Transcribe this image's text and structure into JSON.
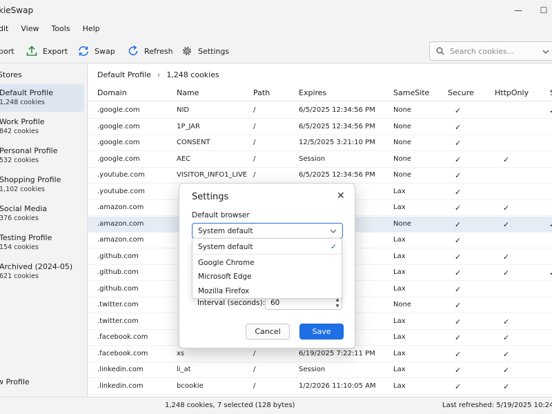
{
  "window": {
    "title": "kieSwap",
    "minimize_glyph": "—",
    "maximize_glyph": "☐"
  },
  "menu": [
    "dit",
    "View",
    "Tools",
    "Help"
  ],
  "toolbar": {
    "import_label": "port",
    "export_label": "Export",
    "swap_label": "Swap",
    "refresh_label": "Refresh",
    "settings_label": "Settings",
    "accent_color": "#1f6fe5",
    "export_icon_color": "#2f8f3a"
  },
  "search": {
    "placeholder": "Search cookies..."
  },
  "sidebar": {
    "header": "Stores",
    "profiles": [
      {
        "name": "Default Profile",
        "count": "1,248 cookies"
      },
      {
        "name": "Work Profile",
        "count": "842 cookies"
      },
      {
        "name": "Personal Profile",
        "count": "532 cookies"
      },
      {
        "name": "Shopping Profile",
        "count": "1,102 cookies"
      },
      {
        "name": "Social Media",
        "count": "376 cookies"
      },
      {
        "name": "Testing Profile",
        "count": "154 cookies"
      },
      {
        "name": "Archived (2024-05)",
        "count": "621 cookies"
      }
    ],
    "new_profile": "w Profile"
  },
  "breadcrumb": {
    "profile": "Default Profile",
    "count": "1,248 cookies"
  },
  "table": {
    "columns": [
      "Domain",
      "Name",
      "Path",
      "Expires",
      "SameSite",
      "Secure",
      "HttpOnly",
      "S"
    ],
    "check_glyph": "✓",
    "rows": [
      {
        "domain": ".google.com",
        "name": "NID",
        "path": "/",
        "expires": "6/5/2025 12:34:56 PM",
        "samesite": "None",
        "secure": "✓",
        "httponly": "",
        "extra": "✓"
      },
      {
        "domain": ".google.com",
        "name": "1P_JAR",
        "path": "/",
        "expires": "6/5/2025 12:34:56 PM",
        "samesite": "None",
        "secure": "✓",
        "httponly": "",
        "extra": ""
      },
      {
        "domain": ".google.com",
        "name": "CONSENT",
        "path": "/",
        "expires": "12/5/2025 3:21:10 PM",
        "samesite": "None",
        "secure": "✓",
        "httponly": "",
        "extra": ""
      },
      {
        "domain": ".google.com",
        "name": "AEC",
        "path": "/",
        "expires": "Session",
        "samesite": "None",
        "secure": "✓",
        "httponly": "✓",
        "extra": ""
      },
      {
        "domain": ".youtube.com",
        "name": "VISITOR_INFO1_LIVE",
        "path": "/",
        "expires": "6/5/2025 12:34:56 PM",
        "samesite": "None",
        "secure": "✓",
        "httponly": "",
        "extra": ""
      },
      {
        "domain": ".youtube.com",
        "name": "",
        "path": "",
        "expires": "",
        "samesite": "Lax",
        "secure": "✓",
        "httponly": "",
        "extra": ""
      },
      {
        "domain": ".amazon.com",
        "name": "",
        "path": "",
        "expires": "AM",
        "samesite": "Lax",
        "secure": "✓",
        "httponly": "✓",
        "extra": ""
      },
      {
        "domain": ".amazon.com",
        "name": "",
        "path": "",
        "expires": "AM",
        "samesite": "None",
        "secure": "✓",
        "httponly": "✓",
        "extra": "✓"
      },
      {
        "domain": ".amazon.com",
        "name": "",
        "path": "",
        "expires": "",
        "samesite": "Lax",
        "secure": "✓",
        "httponly": "",
        "extra": ""
      },
      {
        "domain": ".github.com",
        "name": "",
        "path": "",
        "expires": "",
        "samesite": "Lax",
        "secure": "✓",
        "httponly": "✓",
        "extra": ""
      },
      {
        "domain": ".github.com",
        "name": "",
        "path": "",
        "expires": "AM",
        "samesite": "Lax",
        "secure": "✓",
        "httponly": "✓",
        "extra": "✓"
      },
      {
        "domain": ".github.com",
        "name": "",
        "path": "",
        "expires": "AM",
        "samesite": "Lax",
        "secure": "✓",
        "httponly": "",
        "extra": ""
      },
      {
        "domain": ".twitter.com",
        "name": "",
        "path": "",
        "expires": "PM",
        "samesite": "None",
        "secure": "✓",
        "httponly": "",
        "extra": ""
      },
      {
        "domain": ".twitter.com",
        "name": "",
        "path": "",
        "expires": "PM",
        "samesite": "Lax",
        "secure": "✓",
        "httponly": "✓",
        "extra": ""
      },
      {
        "domain": ".facebook.com",
        "name": "",
        "path": "",
        "expires": "PM",
        "samesite": "Lax",
        "secure": "✓",
        "httponly": "✓",
        "extra": ""
      },
      {
        "domain": ".facebook.com",
        "name": "xs",
        "path": "/",
        "expires": "6/19/2025 7:22:11 PM",
        "samesite": "Lax",
        "secure": "✓",
        "httponly": "✓",
        "extra": ""
      },
      {
        "domain": ".linkedin.com",
        "name": "li_at",
        "path": "/",
        "expires": "Session",
        "samesite": "Lax",
        "secure": "✓",
        "httponly": "✓",
        "extra": ""
      },
      {
        "domain": ".linkedin.com",
        "name": "bcookie",
        "path": "/",
        "expires": "1/2/2026 11:10:05 AM",
        "samesite": "Lax",
        "secure": "✓",
        "httponly": "✓",
        "extra": ""
      }
    ]
  },
  "status": {
    "summary": "1,248 cookies, 7 selected (128 bytes)",
    "last_refreshed": "Last refreshed: 5/19/2025 10:24:31 AM"
  },
  "settings_dialog": {
    "title": "Settings",
    "close_glyph": "✕",
    "default_browser_label": "Default browser",
    "selected_browser": "System default",
    "options": [
      "System default",
      "Google Chrome",
      "Microsoft Edge",
      "Mozilla Firefox"
    ],
    "interval_label": "Interval (seconds):",
    "interval_value": "60",
    "cancel_label": "Cancel",
    "save_label": "Save"
  }
}
